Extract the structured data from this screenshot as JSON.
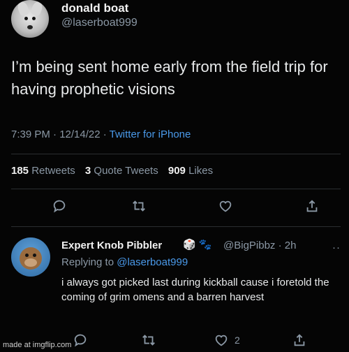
{
  "tweet": {
    "display_name": "donald boat",
    "handle": "@laserboat999",
    "text": "I’m being sent home early from the field trip for having prophetic visions",
    "time_date": "7:39 PM · 12/14/22 · ",
    "source": "Twitter for iPhone",
    "retweets_count": "185",
    "retweets_label": "Retweets",
    "quotes_count": "3",
    "quotes_label": "Quote Tweets",
    "likes_count": "909",
    "likes_label": "Likes"
  },
  "reply": {
    "display_name": "Expert Knob Pibbler",
    "badges": "🎲 🐾",
    "handle_time": "@BigPibbz · 2h",
    "replying_prefix": "Replying to ",
    "replying_handle": "@laserboat999",
    "text": "i always got picked last during kickball cause i foretold the coming of grim omens and a barren harvest",
    "like_count": "2",
    "more": "··"
  },
  "watermark": "made at imgflip.com",
  "icons": [
    "reply-icon",
    "retweet-icon",
    "like-icon",
    "share-icon"
  ],
  "colors": {
    "background": "#050505",
    "link": "#4a99e9",
    "muted": "#8b98a5"
  }
}
